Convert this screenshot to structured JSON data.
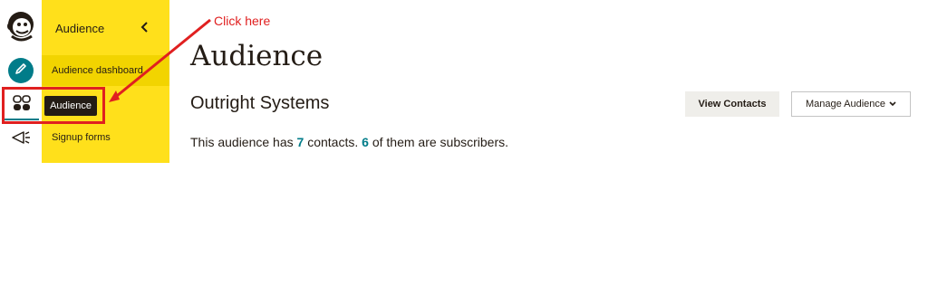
{
  "rail": {
    "logo_icon": "mailchimp-freddie-icon",
    "create_icon": "pencil-icon",
    "audience_icon": "audience-icon",
    "campaigns_icon": "megaphone-icon"
  },
  "subnav": {
    "title": "Audience",
    "collapse_icon": "chevron-left-icon",
    "items": [
      {
        "label": "Audience dashboard",
        "active": true
      },
      {
        "label": "Signup forms",
        "active": false
      }
    ]
  },
  "tooltip": {
    "text": "Audience"
  },
  "annotation": {
    "text": "Click here",
    "color": "#e02020"
  },
  "main": {
    "title": "Audience",
    "audience_name": "Outright Systems",
    "summary_prefix": "This audience has ",
    "contacts_count": "7",
    "summary_middle": " contacts. ",
    "subscribers_count": "6",
    "summary_suffix": " of them are subscribers.",
    "view_contacts_label": "View Contacts",
    "manage_audience_label": "Manage Audience"
  },
  "colors": {
    "accent": "#007c89",
    "brand_yellow": "#ffe01b",
    "text": "#241c15",
    "annotation_red": "#e02020"
  }
}
